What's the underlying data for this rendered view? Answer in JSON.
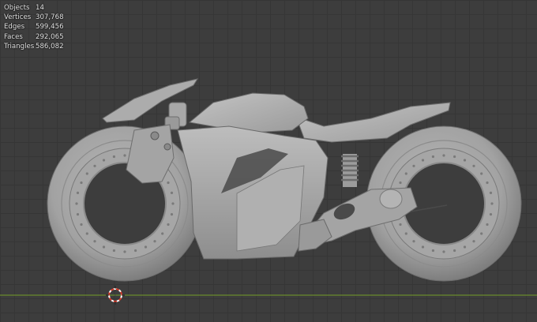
{
  "viewport": {
    "background": "#3d3d3d",
    "grid_color": "#363636",
    "x_axis_color": "#6a8a2c",
    "model_color": "#a9a9a9"
  },
  "stats": [
    {
      "label": "Objects",
      "value": "14"
    },
    {
      "label": "Vertices",
      "value": "307,768"
    },
    {
      "label": "Edges",
      "value": "599,456"
    },
    {
      "label": "Faces",
      "value": "292,065"
    },
    {
      "label": "Triangles",
      "value": "586,082"
    }
  ],
  "icons": {
    "cursor": "3d-cursor-icon"
  }
}
